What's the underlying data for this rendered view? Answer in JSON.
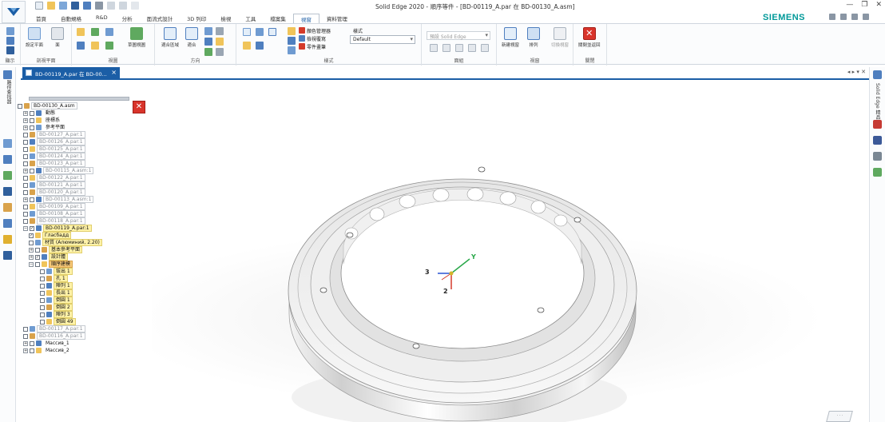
{
  "window": {
    "title": "Solid Edge 2020 - 順序等件 - [BD-00119_A.par 在 BD-00130_A.asm]",
    "brand": "SIEMENS"
  },
  "menu_tabs": [
    "首頁",
    "自動規格",
    "R&D",
    "分析",
    "面流式設計",
    "3D 列印",
    "檢視",
    "工具",
    "檔案集",
    "視窗",
    "資料管理"
  ],
  "active_menu_tab": "視窗",
  "ribbon": {
    "groups": [
      {
        "label": "顯示"
      },
      {
        "label": "剖視平面"
      },
      {
        "label": "視圖"
      },
      {
        "label": "方向"
      },
      {
        "label": "樣式"
      },
      {
        "label": "面組"
      },
      {
        "label": "視窗"
      },
      {
        "label": "關閉"
      }
    ],
    "buttons": {
      "show": "顯示",
      "section_plane": "設定平面",
      "section_2": "面",
      "named_view": "草圖視圖",
      "fit": "適合區域",
      "rotate": "適合",
      "color_manager": "顏色管理器",
      "view_overrides": "檢視覆寫",
      "part_painter": "零件畫筆",
      "style_label": "樣式",
      "new_window": "新建視窗",
      "arrange": "排列",
      "switch_window": "切換視窗",
      "close_window": "關閉並返回"
    },
    "style_dropdown": "Default",
    "scene_dropdown": "預設 Solid Edge"
  },
  "doc_tab": {
    "label": "BD-00119_A.par 在 BD-00...",
    "close": "×"
  },
  "left_toolbar_text": "路徑查找器",
  "right_toolbar_text": "Solid Edge 精品",
  "tree": [
    {
      "text": "BD-00130_A.asm",
      "style": "boxed-bright",
      "indent": 0,
      "expander": "",
      "check": false
    },
    {
      "text": "動態",
      "style": "bright",
      "indent": 1,
      "expander": "+",
      "check": false
    },
    {
      "text": "座標系",
      "style": "bright",
      "indent": 1,
      "expander": "+",
      "check": false
    },
    {
      "text": "參考平面",
      "style": "bright",
      "indent": 1,
      "expander": "+",
      "check": false
    },
    {
      "text": "BD-00127_A.par:1",
      "style": "boxed",
      "indent": 1,
      "expander": "",
      "check": false
    },
    {
      "text": "BD-00126_A.par:1",
      "style": "boxed",
      "indent": 1,
      "expander": "",
      "check": false
    },
    {
      "text": "BD-00125_A.par:1",
      "style": "boxed",
      "indent": 1,
      "expander": "",
      "check": false
    },
    {
      "text": "BD-00124_A.par:1",
      "style": "boxed",
      "indent": 1,
      "expander": "",
      "check": false
    },
    {
      "text": "BD-00123_A.par:1",
      "style": "boxed",
      "indent": 1,
      "expander": "",
      "check": false
    },
    {
      "text": "BD-00115_A.asm:1",
      "style": "boxed",
      "indent": 1,
      "expander": "+",
      "check": false
    },
    {
      "text": "BD-00122_A.par:1",
      "style": "boxed",
      "indent": 1,
      "expander": "",
      "check": false
    },
    {
      "text": "BD-00121_A.par:1",
      "style": "boxed",
      "indent": 1,
      "expander": "",
      "check": false
    },
    {
      "text": "BD-00120_A.par:1",
      "style": "boxed",
      "indent": 1,
      "expander": "",
      "check": false
    },
    {
      "text": "BD-00113_A.asm:1",
      "style": "boxed",
      "indent": 1,
      "expander": "+",
      "check": false
    },
    {
      "text": "BD-00109_A.par:1",
      "style": "boxed",
      "indent": 1,
      "expander": "",
      "check": false
    },
    {
      "text": "BD-00108_A.par:1",
      "style": "boxed",
      "indent": 1,
      "expander": "",
      "check": false
    },
    {
      "text": "BD-00118_A.par:1",
      "style": "boxed",
      "indent": 1,
      "expander": "",
      "check": false
    },
    {
      "text": "BD-00119_A.par:1",
      "style": "hl",
      "indent": 1,
      "expander": "-",
      "check": true
    },
    {
      "text": "Гласбадд",
      "style": "hl",
      "indent": 2,
      "expander": "",
      "check": true
    },
    {
      "text": "材質 (Алюминий, 2.20)",
      "style": "hl",
      "indent": 2,
      "expander": "",
      "check": false
    },
    {
      "text": "基本參考平面",
      "style": "hl",
      "indent": 2,
      "expander": "+",
      "check": false
    },
    {
      "text": "設計體",
      "style": "hl",
      "indent": 2,
      "expander": "+",
      "check": true
    },
    {
      "text": "順序建模",
      "style": "hl-orange",
      "indent": 2,
      "expander": "-",
      "check": false
    },
    {
      "text": "拔出 1",
      "style": "hl",
      "indent": 4,
      "expander": "",
      "check": false
    },
    {
      "text": "孔 1",
      "style": "hl",
      "indent": 4,
      "expander": "",
      "check": false
    },
    {
      "text": "陣列 1",
      "style": "hl",
      "indent": 4,
      "expander": "",
      "check": false
    },
    {
      "text": "長出 1",
      "style": "hl",
      "indent": 4,
      "expander": "",
      "check": false
    },
    {
      "text": "倒圓 1",
      "style": "hl",
      "indent": 4,
      "expander": "",
      "check": false
    },
    {
      "text": "倒圓 2",
      "style": "hl",
      "indent": 4,
      "expander": "",
      "check": false
    },
    {
      "text": "陣列 3",
      "style": "hl",
      "indent": 4,
      "expander": "",
      "check": false
    },
    {
      "text": "倒圓 49",
      "style": "hl",
      "indent": 4,
      "expander": "",
      "check": false
    },
    {
      "text": "BD-00117_A.par:1",
      "style": "boxed",
      "indent": 1,
      "expander": "",
      "check": false
    },
    {
      "text": "BD-00116_A.par:1",
      "style": "boxed",
      "indent": 1,
      "expander": "",
      "check": false
    },
    {
      "text": "Массив_1",
      "style": "bright",
      "indent": 1,
      "expander": "+",
      "check": false
    },
    {
      "text": "Массив_2",
      "style": "bright",
      "indent": 1,
      "expander": "+",
      "check": false
    }
  ],
  "axes": {
    "x": "3",
    "y": "Y",
    "z": "2"
  },
  "colors": {
    "accent": "#1b5ea6",
    "brand": "#009999",
    "close_red": "#d9342b",
    "tree_highlight": "#fff2a8",
    "axis_x": "#d43a2a",
    "axis_y": "#2aa84a",
    "axis_z": "#2a55d4"
  }
}
